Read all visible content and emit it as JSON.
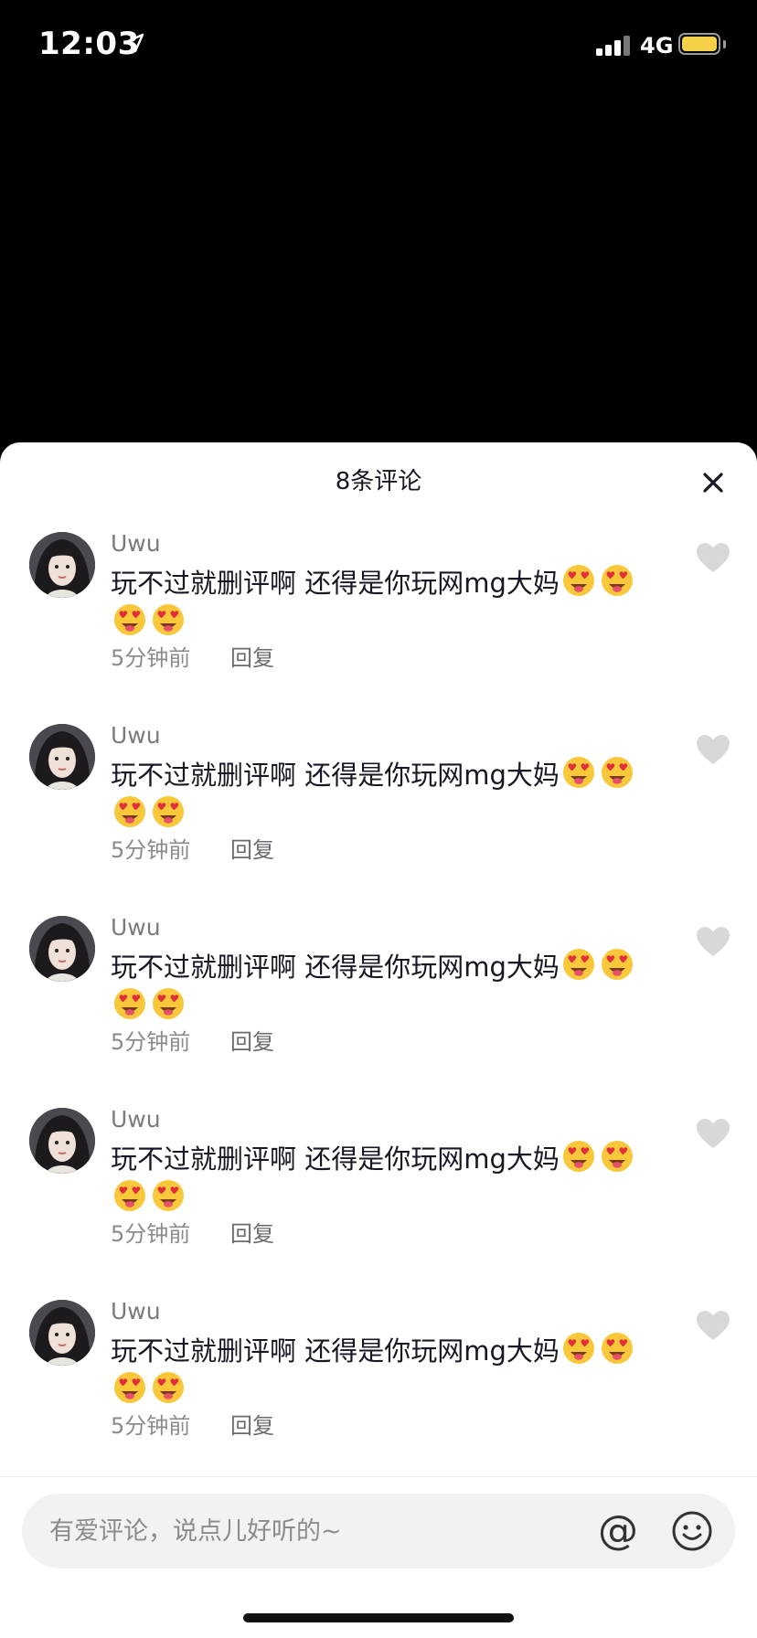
{
  "status_bar": {
    "time": "12:03",
    "network": "4G",
    "battery_color": "#f5d14a",
    "location_icon": "location-arrow-icon"
  },
  "sheet": {
    "title": "8条评论",
    "close_icon": "close-icon"
  },
  "comments": [
    {
      "username": "Uwu",
      "text": "玩不过就删评啊 还得是你玩网mg大妈",
      "emoji": "star-struck-emoji",
      "emoji_count": 4,
      "time": "5分钟前",
      "reply_label": "回复"
    },
    {
      "username": "Uwu",
      "text": "玩不过就删评啊 还得是你玩网mg大妈",
      "emoji": "star-struck-emoji",
      "emoji_count": 4,
      "time": "5分钟前",
      "reply_label": "回复"
    },
    {
      "username": "Uwu",
      "text": "玩不过就删评啊 还得是你玩网mg大妈",
      "emoji": "star-struck-emoji",
      "emoji_count": 4,
      "time": "5分钟前",
      "reply_label": "回复"
    },
    {
      "username": "Uwu",
      "text": "玩不过就删评啊 还得是你玩网mg大妈",
      "emoji": "star-struck-emoji",
      "emoji_count": 4,
      "time": "5分钟前",
      "reply_label": "回复"
    },
    {
      "username": "Uwu",
      "text": "玩不过就删评啊 还得是你玩网mg大妈",
      "emoji": "star-struck-emoji",
      "emoji_count": 4,
      "time": "5分钟前",
      "reply_label": "回复"
    }
  ],
  "input": {
    "placeholder": "有爱评论，说点儿好听的~",
    "at_label": "@"
  },
  "colors": {
    "sheet_bg": "#ffffff",
    "text_primary": "#161823",
    "text_secondary": "#8a8b91",
    "like_icon": "#d8d8d8"
  }
}
